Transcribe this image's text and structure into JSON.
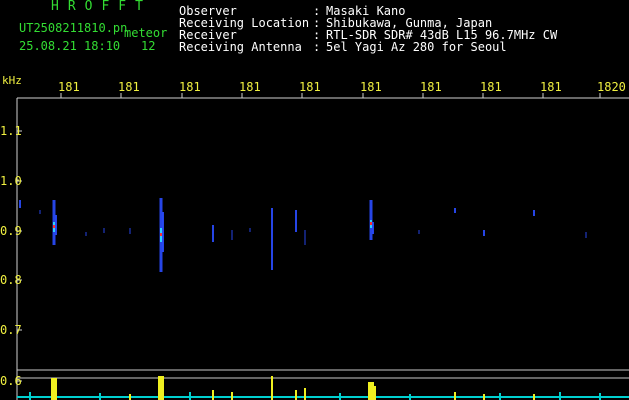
{
  "header": {
    "brand": "HROFFT",
    "file_name": "UT2508211810.pn",
    "file_suffix": "meteor",
    "timestamp": "25.08.21 18:10",
    "count": "12"
  },
  "meta": [
    {
      "label": "Observer",
      "value": "Masaki Kano"
    },
    {
      "label": "Receiving Location",
      "value": "Shibukawa, Gunma, Japan"
    },
    {
      "label": "Receiver",
      "value": "RTL-SDR SDR# 43dB L15 96.7MHz CW"
    },
    {
      "label": "Receiving Antenna",
      "value": "5el Yagi Az 280 for Seoul"
    }
  ],
  "x_axis": {
    "ticks": [
      "181",
      "181",
      "181",
      "181",
      "181",
      "181",
      "181",
      "181",
      "181",
      "1820"
    ]
  },
  "y_axis": {
    "unit": "kHz",
    "ticks": [
      "1.1",
      "1.0",
      "0.9",
      "0.8",
      "0.7",
      "0.6"
    ]
  },
  "colors": {
    "background": "#000000",
    "header_text": "#33dd33",
    "axis_text": "#f0f040",
    "meta_text": "#ffffff",
    "signal": "#2a4dff",
    "signal_hot": "#ff3030"
  }
}
